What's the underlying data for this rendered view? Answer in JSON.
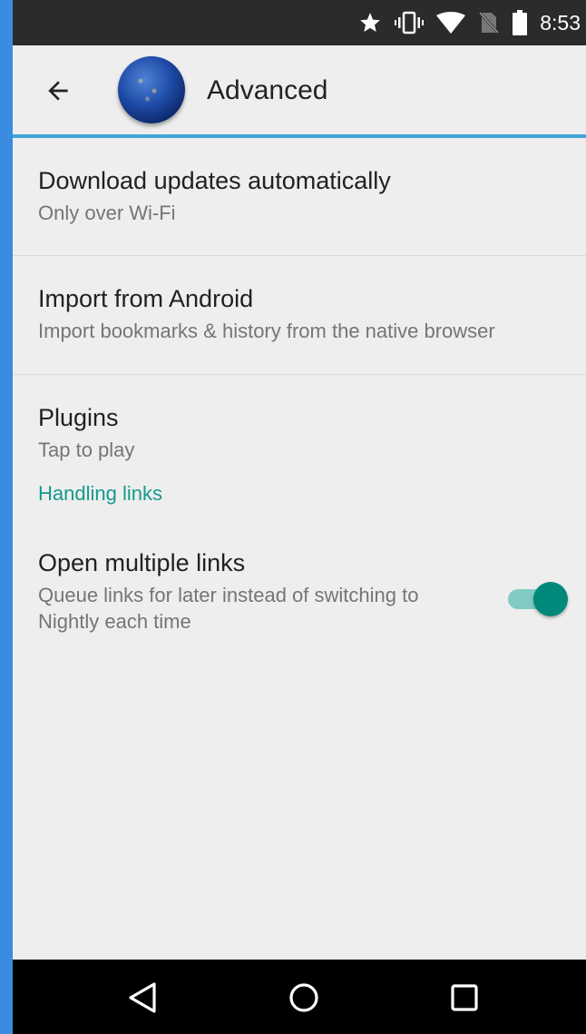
{
  "status_bar": {
    "time": "8:53",
    "icons": [
      "star-icon",
      "vibrate-icon",
      "wifi-icon",
      "no-sim-icon",
      "battery-icon"
    ]
  },
  "toolbar": {
    "back_icon": "arrow-back-icon",
    "title": "Advanced"
  },
  "preferences": [
    {
      "title": "Download updates automatically",
      "summary": "Only over Wi-Fi"
    },
    {
      "title": "Import from Android",
      "summary": "Import bookmarks & history from the native browser"
    },
    {
      "title": "Plugins",
      "summary": "Tap to play"
    }
  ],
  "handling_links": {
    "category_label": "Handling links",
    "open_multiple_links": {
      "title": "Open multiple links",
      "summary": "Queue links for later instead of switching to Nightly each time",
      "enabled": true
    }
  },
  "navigation_bar": {
    "buttons": [
      "back-triangle-icon",
      "home-circle-icon",
      "recents-square-icon"
    ]
  },
  "colors": {
    "accent": "#169a8d",
    "toggle_thumb": "#00897b",
    "toolbar_underline": "#42a5d6"
  }
}
